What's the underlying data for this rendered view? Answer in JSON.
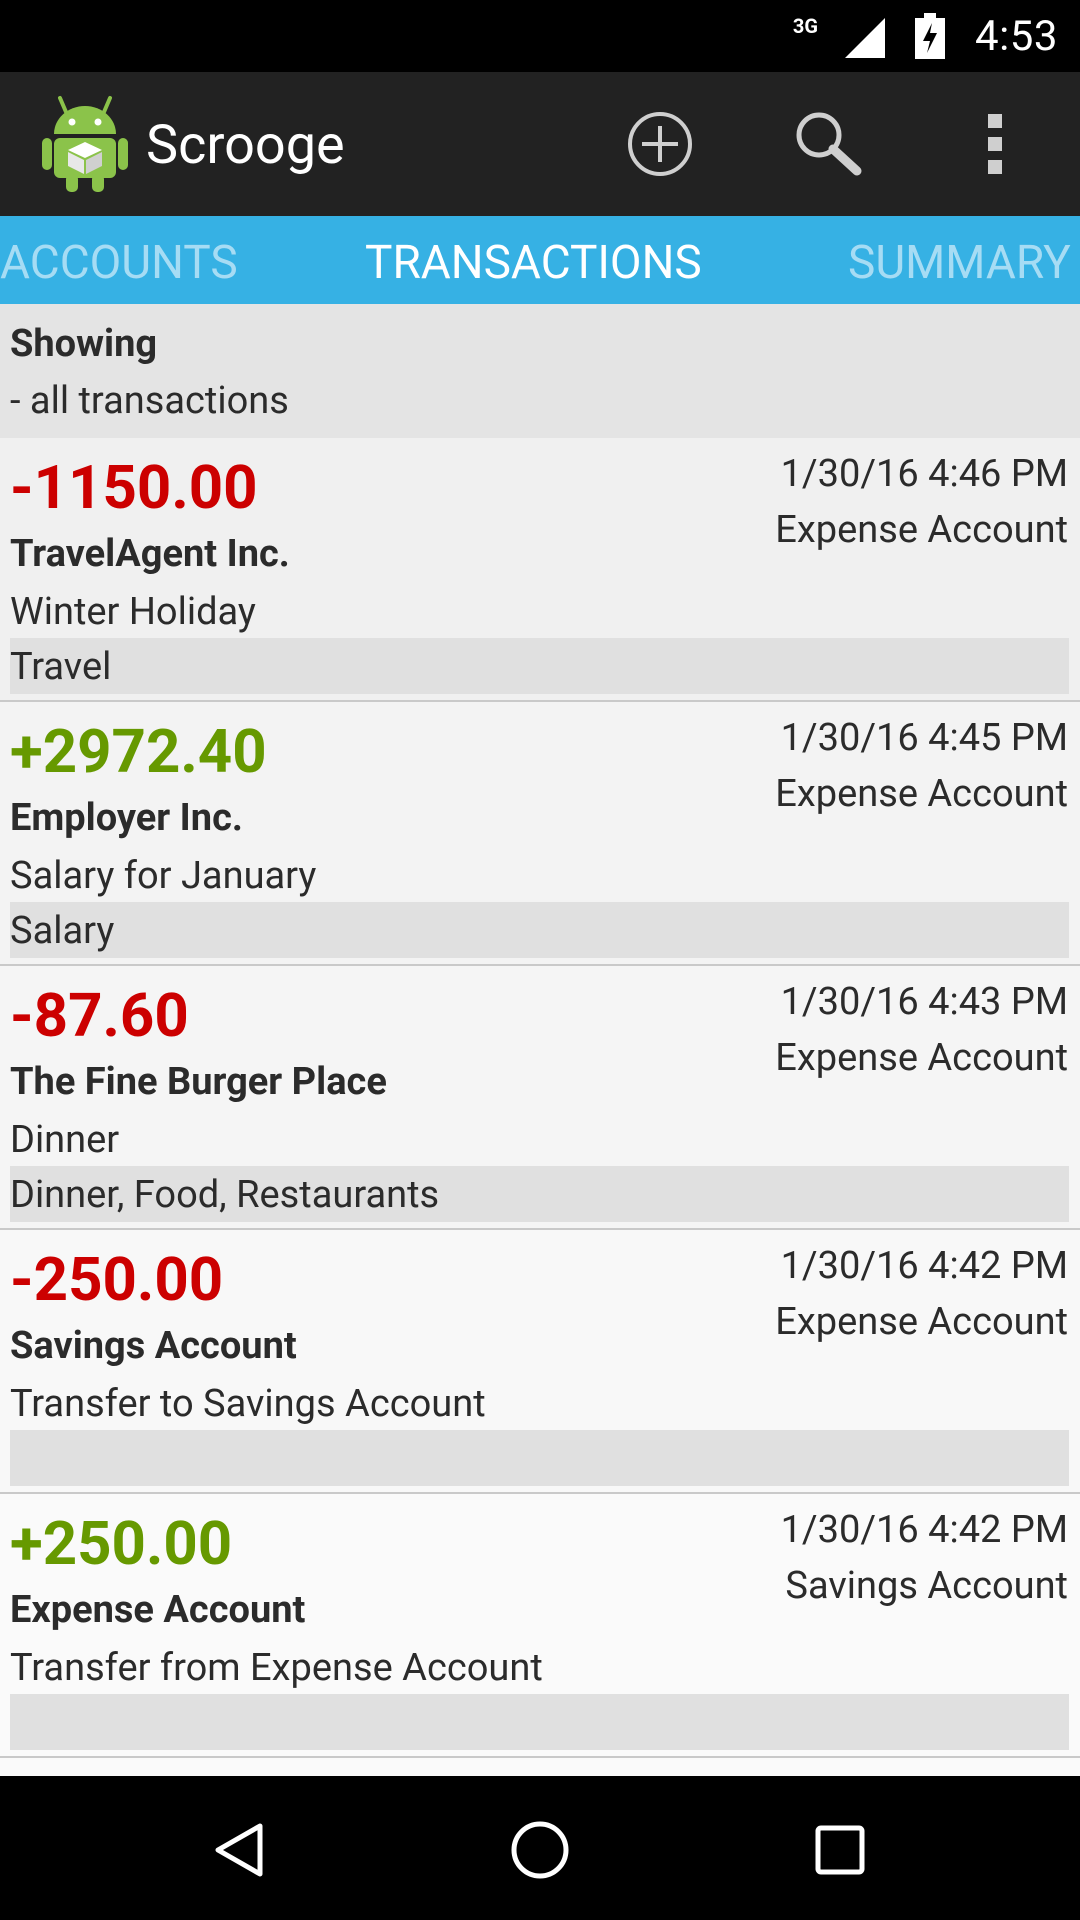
{
  "status_bar": {
    "network": "3G",
    "time": "4:53"
  },
  "app": {
    "title": "Scrooge"
  },
  "action_bar": {
    "icons": [
      "add-circle-icon",
      "search-icon",
      "overflow-menu-icon"
    ]
  },
  "tabs": [
    {
      "label": "ACCOUNTS",
      "selected": false
    },
    {
      "label": "TRANSACTIONS",
      "selected": true
    },
    {
      "label": "SUMMARY",
      "selected": false
    }
  ],
  "filter": {
    "title": "Showing",
    "subtitle": "- all transactions"
  },
  "transactions": [
    {
      "amount": "-1150.00",
      "sign": "negative",
      "payee": "TravelAgent Inc.",
      "description": "Winter Holiday",
      "category": "Travel",
      "datetime": "1/30/16 4:46 PM",
      "account": "Expense Account"
    },
    {
      "amount": "+2972.40",
      "sign": "positive",
      "payee": "Employer Inc.",
      "description": "Salary for January",
      "category": "Salary",
      "datetime": "1/30/16 4:45 PM",
      "account": "Expense Account"
    },
    {
      "amount": "-87.60",
      "sign": "negative",
      "payee": "The Fine Burger Place",
      "description": "Dinner",
      "category": "Dinner, Food, Restaurants",
      "datetime": "1/30/16 4:43 PM",
      "account": "Expense Account"
    },
    {
      "amount": "-250.00",
      "sign": "negative",
      "payee": "Savings Account",
      "description": "Transfer to Savings Account",
      "category": "",
      "datetime": "1/30/16 4:42 PM",
      "account": "Expense Account"
    },
    {
      "amount": "+250.00",
      "sign": "positive",
      "payee": "Expense Account",
      "description": "Transfer from Expense Account",
      "category": "",
      "datetime": "1/30/16 4:42 PM",
      "account": "Savings Account"
    }
  ],
  "colors": {
    "negative": "#cc0000",
    "positive": "#669900",
    "tab_bar": "#36b1e4",
    "action_bar": "#222222"
  },
  "nav_bar": {
    "icons": [
      "back-icon",
      "home-icon",
      "recent-apps-icon"
    ]
  }
}
